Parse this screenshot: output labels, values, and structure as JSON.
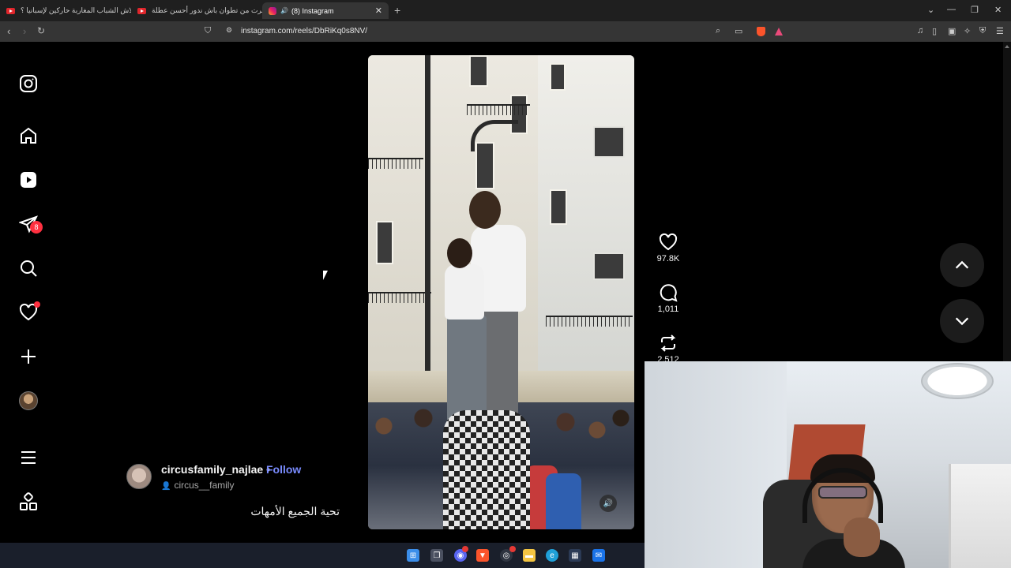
{
  "browser": {
    "tabs": [
      {
        "title": "علاش الشباب المغاربة حاركين لإسبانيا ؟",
        "icon": "youtube-icon"
      },
      {
        "title": "سافرت من تطوان باش ندور أحسن عطلة",
        "icon": "youtube-icon"
      },
      {
        "title": "(8) Instagram",
        "icon": "instagram-icon",
        "active": true
      }
    ],
    "url": "instagram.com/reels/DbRiKq0s8NV/"
  },
  "sidebar": {
    "notification_count": "8",
    "items": [
      "instagram-logo-icon",
      "home-icon",
      "reels-icon",
      "messages-icon",
      "search-icon",
      "notifications-icon",
      "create-icon",
      "profile-avatar",
      "menu-icon",
      "more-apps-icon"
    ]
  },
  "reel": {
    "author": "circusfamily_najlae",
    "separator": "•",
    "follow_label": "Follow",
    "audio": "circus__family",
    "caption": "تحية الجميع الأمهات",
    "likes": "97.8K",
    "comments": "1,011",
    "reposts": "2,512"
  },
  "colors": {
    "follow": "#7a8cff",
    "badge": "#ff3040",
    "background": "#000000"
  }
}
